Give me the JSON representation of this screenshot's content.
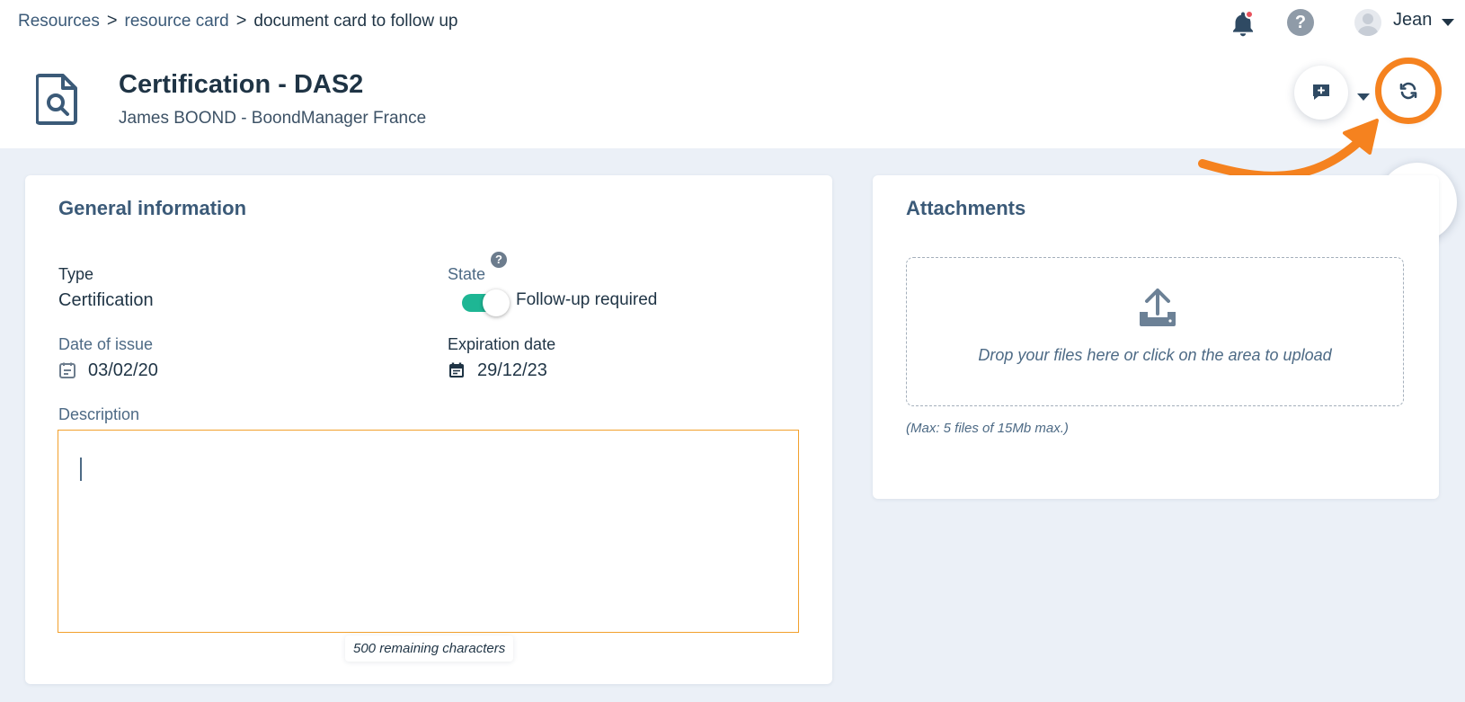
{
  "breadcrumb": {
    "items": [
      "Resources",
      "resource card"
    ],
    "current": "document card to follow up",
    "separator": ">"
  },
  "header": {
    "user_name": "Jean",
    "title": "Certification - DAS2",
    "subtitle": "James BOOND - BoondManager France"
  },
  "general": {
    "title": "General information",
    "type_label": "Type",
    "type_value": "Certification",
    "state_label": "State",
    "state_help": "?",
    "state_toggle_text": "Follow-up required",
    "state_toggle_on": true,
    "issue_label": "Date of issue",
    "issue_value": "03/02/20",
    "expiration_label": "Expiration date",
    "expiration_value": "29/12/23",
    "description_label": "Description",
    "description_value": "",
    "remaining_text": "500 remaining characters"
  },
  "attachments": {
    "title": "Attachments",
    "drop_text": "Drop your files here or click on the area to upload",
    "limits_text": "(Max: 5 files of 15Mb max.)"
  },
  "icons": {
    "notification": "bell-icon",
    "help": "help-icon",
    "document": "document-search-icon",
    "comment": "comment-plus-icon",
    "refresh": "refresh-icon",
    "save": "floppy-disk-icon",
    "calendar": "calendar-icon",
    "upload": "upload-icon"
  },
  "colors": {
    "accent_orange": "#f5821f",
    "toggle_on": "#1eb694",
    "notification_dot": "#e8515c",
    "page_bg": "#ebf0f7",
    "focus_border": "#f2a02c"
  }
}
